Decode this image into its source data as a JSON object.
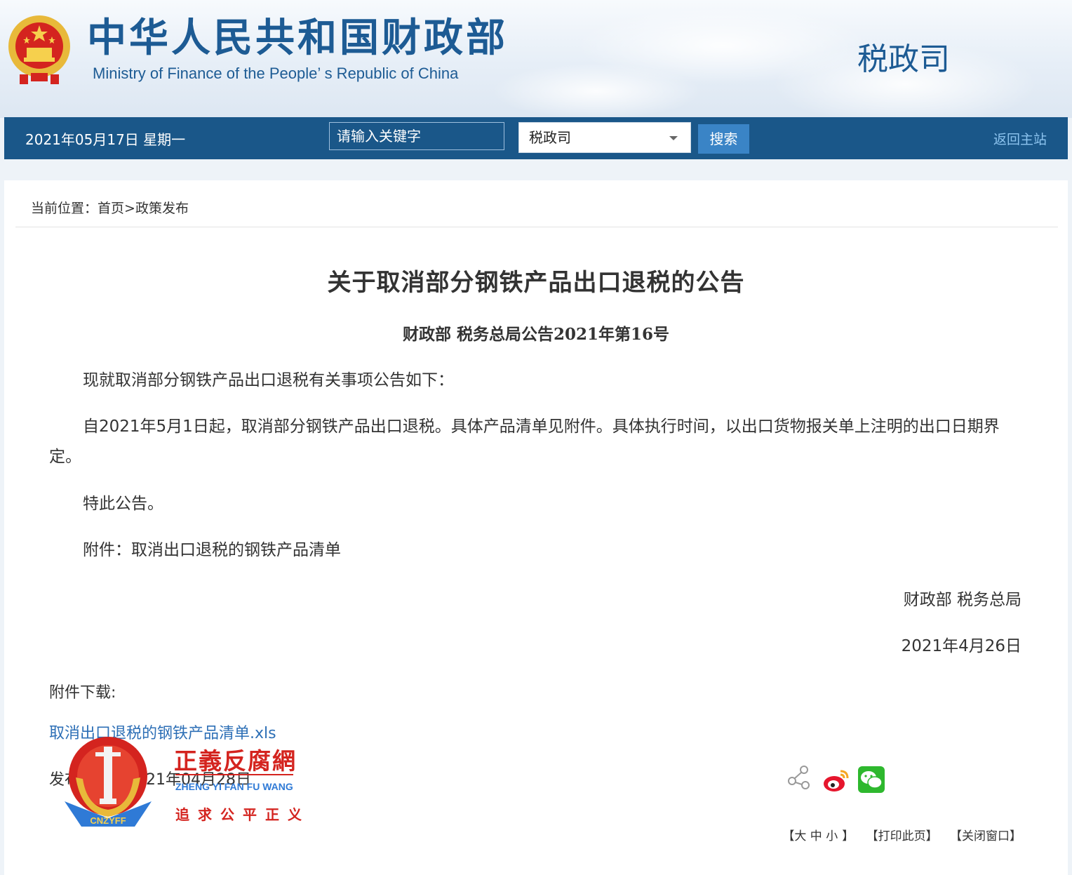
{
  "header": {
    "site_title": "中华人民共和国财政部",
    "site_subtitle": "Ministry of Finance of the People’ s Republic of China",
    "dept_name": "税政司"
  },
  "nav": {
    "date": "2021年05月17日  星期一",
    "search_placeholder": "请输入关键字",
    "scope_value": "税政司",
    "search_button": "搜索",
    "home_link": "返回主站"
  },
  "breadcrumb": {
    "prefix": "当前位置：",
    "home": "首页",
    "separator": ">",
    "section": "政策发布"
  },
  "article": {
    "title": "关于取消部分钢铁产品出口退税的公告",
    "doc_number": "财政部  税务总局公告2021年第16号",
    "paragraphs": [
      "现就取消部分钢铁产品出口退税有关事项公告如下：",
      "自2021年5月1日起，取消部分钢铁产品出口退税。具体产品清单见附件。具体执行时间，以出口货物报关单上注明的出口日期界定。",
      "特此公告。",
      "附件：取消出口退税的钢铁产品清单"
    ],
    "signer": "财政部  税务总局",
    "sign_date": "2021年4月26日",
    "attachment_label": "附件下载:",
    "attachment_file": "取消出口退税的钢铁产品清单.xls",
    "publish_date": "发布日期：2021年04月28日"
  },
  "share": {
    "icons": [
      "share-icon",
      "weibo-icon",
      "wechat-icon"
    ]
  },
  "tools": {
    "font_open": "【",
    "font_large": "大",
    "font_medium": "中",
    "font_small": "小",
    "font_close": "】",
    "print": "【打印此页】",
    "close": "【关闭窗口】"
  },
  "watermark": {
    "name_cn": "正義反腐網",
    "name_en": "ZHENG YI FAN FU WANG",
    "slogan": "追求公平正义",
    "badge_text": "CNZYFF"
  },
  "colors": {
    "nav_bg": "#1a5789",
    "brand_blue": "#1d5b94",
    "link_blue": "#2d6fb6",
    "button_blue": "#3a84c6",
    "watermark_red": "#d4241f"
  }
}
